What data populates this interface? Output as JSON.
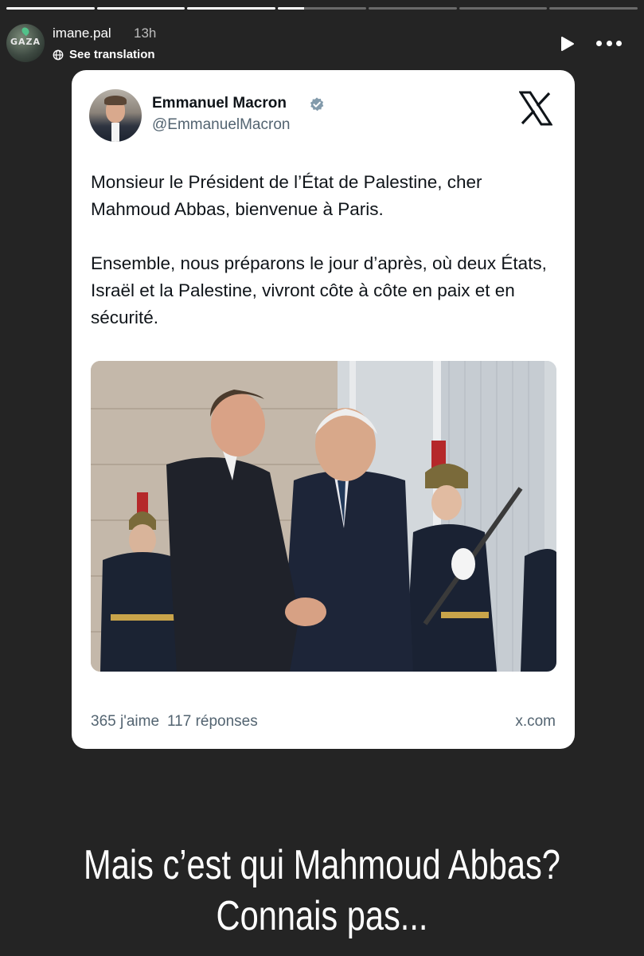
{
  "story": {
    "progress": [
      1,
      1,
      1,
      0.3,
      0,
      0,
      0
    ],
    "username": "imane.pal",
    "time_ago": "13h",
    "see_translation": "See translation",
    "avatar_text": "GAZA"
  },
  "tweet": {
    "author_name": "Emmanuel Macron",
    "handle": "@EmmanuelMacron",
    "paragraphs": [
      "Monsieur le Président de l’État de Palestine, cher Mahmoud Abbas, bienvenue à Paris.",
      "Ensemble, nous préparons le jour d’après, où deux États, Israël et la Palestine, vivront côte à côte en paix et en sécurité."
    ],
    "likes": "365 j'aime",
    "replies": "117 réponses",
    "domain": "x.com"
  },
  "caption": {
    "line1": "Mais c’est qui Mahmoud Abbas?",
    "line2": "Connais pas..."
  },
  "icons": {
    "play": "play-icon",
    "more": "more-icon",
    "verified": "verified-badge-icon",
    "x_logo": "x-logo-icon",
    "globe": "translate-icon"
  },
  "colors": {
    "background": "#242424",
    "card": "#ffffff",
    "verified": "#829aab",
    "muted_text": "#536471"
  }
}
